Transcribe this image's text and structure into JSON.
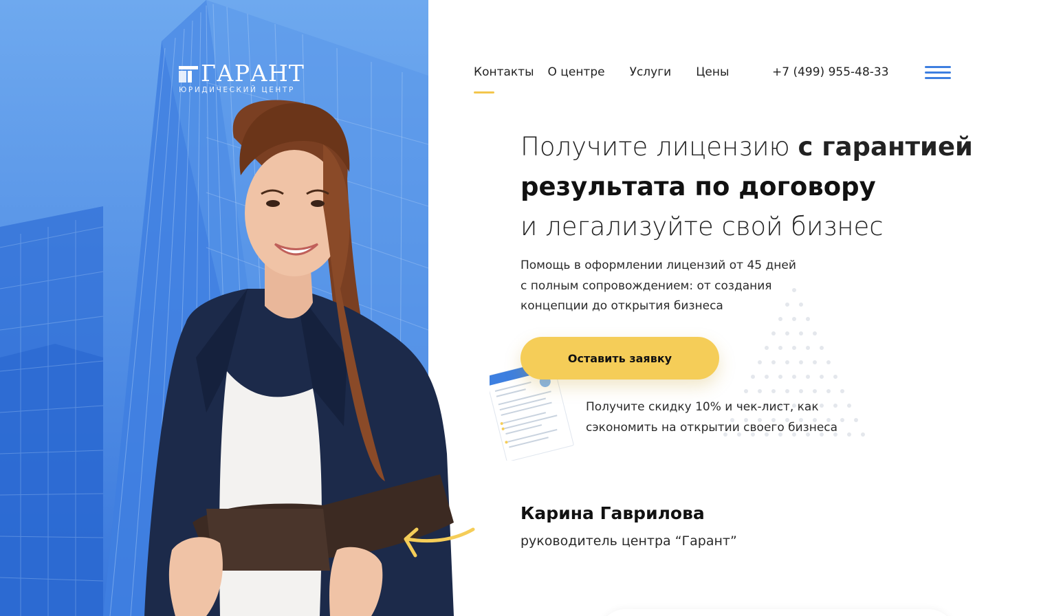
{
  "logo": {
    "name": "ГАРАНТ",
    "subtitle": "ЮРИДИЧЕСКИЙ ЦЕНТР"
  },
  "nav": {
    "items": [
      {
        "label": "Контакты",
        "active": true
      },
      {
        "label": "О центре"
      },
      {
        "label": "Услуги"
      },
      {
        "label": "Цены"
      }
    ],
    "phone": "+7 (499) 955-48-33",
    "menu_icon": "hamburger-menu-icon"
  },
  "hero": {
    "line1_light": "Получите лицензию ",
    "line1_bold": "с гарантией",
    "line2": "результата по договору",
    "line3": "и легализуйте свой бизнес",
    "description": [
      "Помощь в оформлении лицензий от 45 дней",
      "с полным сопровождением: от создания",
      "концепции до открытия бизнеса"
    ],
    "cta_label": "Оставить заявку",
    "promo": [
      "Получите скидку 10% и чек-лист, как",
      "сэкономить на открытии своего бизнеса"
    ]
  },
  "person": {
    "name": "Карина Гаврилова",
    "role": "руководитель центра “Гарант”"
  },
  "colors": {
    "brand_blue": "#4d8fe6",
    "accent_yellow": "#f5cd58",
    "menu_blue": "#3d7fe0"
  }
}
